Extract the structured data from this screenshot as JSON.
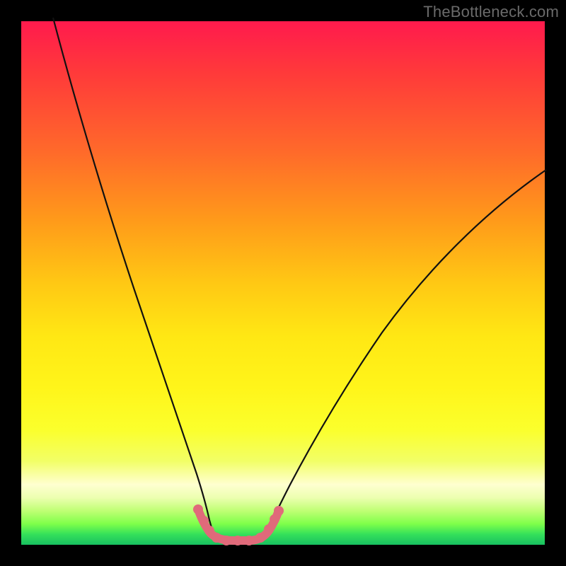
{
  "watermark": "TheBottleneck.com",
  "colors": {
    "curve": "#111111",
    "pink": "#e06a7a",
    "gradient_top": "#ff1a4d",
    "gradient_bottom": "#18c060"
  },
  "chart_data": {
    "type": "line",
    "title": "",
    "xlabel": "",
    "ylabel": "",
    "xlim": [
      0,
      100
    ],
    "ylim": [
      0,
      100
    ],
    "grid": false,
    "legend": false,
    "annotations": [],
    "series": [
      {
        "name": "left-curve",
        "x": [
          5,
          8,
          12,
          16,
          20,
          24,
          28,
          30,
          32,
          34,
          35
        ],
        "y": [
          100,
          88,
          74,
          60,
          46,
          32,
          18,
          12,
          7,
          3,
          1
        ]
      },
      {
        "name": "right-curve",
        "x": [
          45,
          47,
          50,
          54,
          60,
          68,
          78,
          90,
          100
        ],
        "y": [
          1,
          3,
          7,
          13,
          23,
          36,
          50,
          63,
          72
        ]
      },
      {
        "name": "pink-bottom-segment",
        "x": [
          32,
          34,
          36,
          38,
          40,
          42,
          44,
          46,
          48
        ],
        "y": [
          6,
          3,
          1,
          1,
          1,
          1,
          2,
          4,
          7
        ]
      }
    ]
  }
}
